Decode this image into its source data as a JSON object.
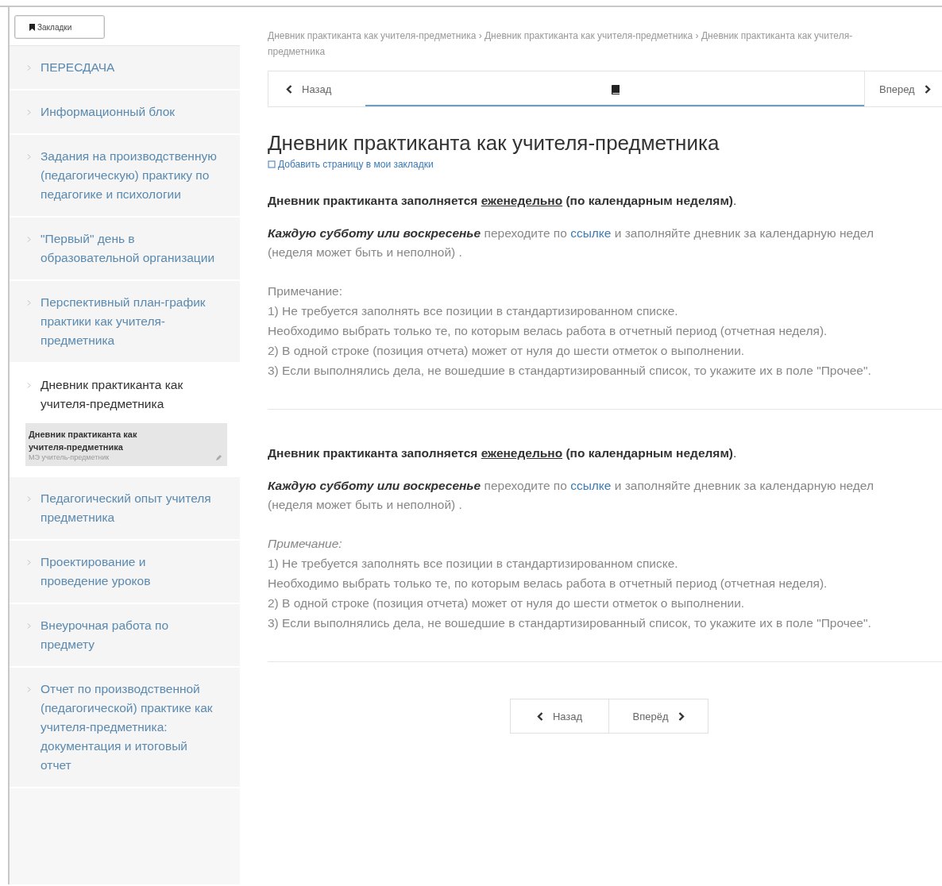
{
  "sidebar": {
    "bookmarks_button": "Закладки",
    "items": [
      {
        "label": "ПЕРЕСДАЧА",
        "selected": false
      },
      {
        "label": "Информационный блок",
        "selected": false
      },
      {
        "label": "Задания на производственную (педагогическую) практику по педагогике и психологии",
        "selected": false
      },
      {
        "label": "\"Первый\" день в образовательной организации",
        "selected": false
      },
      {
        "label": "Перспективный план-график практики как учителя-предметника",
        "selected": false
      },
      {
        "label": "Дневник практиканта как учителя-предметника",
        "selected": true,
        "children": [
          {
            "title": "Дневник практиканта как учителя-предметника",
            "subtitle": "МЭ учитель-предметник"
          }
        ]
      },
      {
        "label": "Педагогический опыт учителя предметника",
        "selected": false
      },
      {
        "label": "Проектирование и проведение уроков",
        "selected": false
      },
      {
        "label": "Внеурочная работа по предмету",
        "selected": false
      },
      {
        "label": "Отчет по производственной (педагогической) практике как учителя-предметника: документация и итоговый отчет",
        "selected": false
      }
    ]
  },
  "breadcrumb": "Дневник практиканта как учителя-предметника › Дневник практиканта как учителя-предметника › Дневник практиканта как учителя-предметника",
  "top_nav": {
    "back": "Назад",
    "forward": "Вперед",
    "level": 1
  },
  "title": "Дневник практиканта как учителя-предметника",
  "add_bookmark": "Добавить страницу в мои закладки",
  "sections": [
    {
      "notice_start": "Дневник практиканта заполняется",
      "notice_underlined": "еженедельно",
      "notice_end": "(по календарным неделям)",
      "notice_tail": ".",
      "lead": "Каждую субботу или воскресенье",
      "text_before_link": "переходите по",
      "link": "ссылке",
      "text_after_link": "и заполняйте дневник за календарную недел",
      "line2": "(неделя может быть и неполной) .",
      "note_label": "Примечание:",
      "note_italic": false,
      "notes": [
        "1) Не требуется заполнять все позиции в стандартизированном списке.",
        "Необходимо выбрать только те, по которым велась работа в отчетный период (отчетная неделя).",
        "2) В одной строке (позиция отчета) может от нуля до шести отметок о выполнении.",
        "3) Если выполнялись дела, не вошедшие в стандартизированный список, то укажите их в поле \"Прочее\"."
      ]
    },
    {
      "notice_start": "Дневник практиканта заполняется",
      "notice_underlined": "еженедельно",
      "notice_end": "(по календарным неделям)",
      "notice_tail": ".",
      "lead": "Каждую субботу или воскресенье",
      "text_before_link": "переходите по",
      "link": "ссылке",
      "text_after_link": "и заполняйте дневник за календарную недел",
      "line2": "(неделя может быть и неполной) .",
      "note_label": "Примечание:",
      "note_italic": true,
      "notes": [
        "1) Не требуется заполнять все позиции в стандартизированном списке.",
        "Необходимо выбрать только те, по которым велась работа в отчетный период (отчетная неделя).",
        "2) В одной строке (позиция отчета) может от нуля до шести отметок о выполнении.",
        "3) Если выполнялись дела, не вошедшие в стандартизированный список, то укажите их в поле \"Прочее\"."
      ]
    }
  ],
  "bottom_nav": {
    "back": "Назад",
    "forward": "Вперёд"
  }
}
